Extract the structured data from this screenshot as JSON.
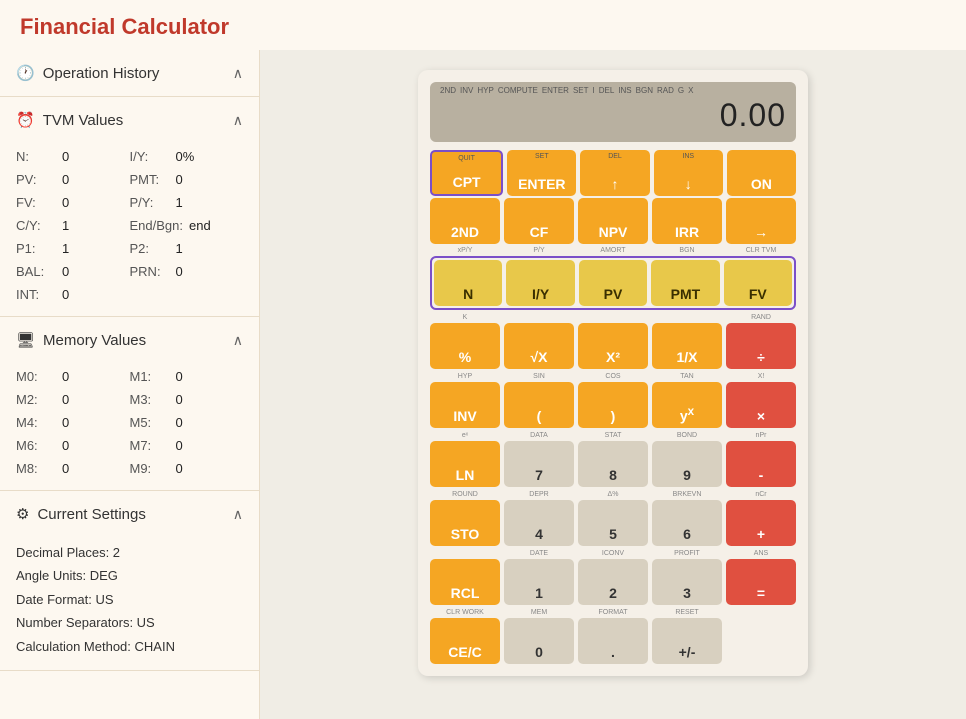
{
  "app": {
    "title": "Financial Calculator"
  },
  "sidebar": {
    "operation_history": {
      "label": "Operation History",
      "icon": "history-icon"
    },
    "tvm": {
      "label": "TVM Values",
      "icon": "clock-icon",
      "fields": [
        {
          "label": "N:",
          "value": "0",
          "label2": "I/Y:",
          "value2": "0%"
        },
        {
          "label": "PV:",
          "value": "0",
          "label2": "PMT:",
          "value2": "0"
        },
        {
          "label": "FV:",
          "value": "0",
          "label2": "P/Y:",
          "value2": "1"
        },
        {
          "label": "C/Y:",
          "value": "1",
          "label2": "End/Bgn:",
          "value2": "end"
        },
        {
          "label": "P1:",
          "value": "1",
          "label2": "P2:",
          "value2": "1"
        },
        {
          "label": "BAL:",
          "value": "0",
          "label2": "PRN:",
          "value2": "0"
        },
        {
          "label": "INT:",
          "value": "0",
          "label2": "",
          "value2": ""
        }
      ]
    },
    "memory": {
      "label": "Memory Values",
      "icon": "memory-icon",
      "fields": [
        {
          "label": "M0:",
          "value": "0",
          "label2": "M1:",
          "value2": "0"
        },
        {
          "label": "M2:",
          "value": "0",
          "label2": "M3:",
          "value2": "0"
        },
        {
          "label": "M4:",
          "value": "0",
          "label2": "M5:",
          "value2": "0"
        },
        {
          "label": "M6:",
          "value": "0",
          "label2": "M7:",
          "value2": "0"
        },
        {
          "label": "M8:",
          "value": "0",
          "label2": "M9:",
          "value2": "0"
        }
      ]
    },
    "settings": {
      "label": "Current Settings",
      "icon": "settings-icon",
      "items": [
        "Decimal Places: 2",
        "Angle Units: DEG",
        "Date Format: US",
        "Number Separators: US",
        "Calculation Method: CHAIN"
      ]
    }
  },
  "calculator": {
    "display": {
      "value": "0.00",
      "top_labels": [
        "2ND",
        "INV",
        "HYP",
        "COMPUTE",
        "ENTER",
        "SET",
        "I",
        "DEL",
        "INS",
        "BGN",
        "RAD",
        "G",
        "X"
      ]
    },
    "rows": [
      {
        "id": "row-quit",
        "buttons": [
          {
            "id": "cpt",
            "label": "CPT",
            "top": "QUIT",
            "color": "orange-outline"
          },
          {
            "id": "enter",
            "label": "ENTER",
            "top": "SET",
            "color": "orange"
          },
          {
            "id": "up",
            "label": "↑",
            "top": "DEL",
            "color": "orange"
          },
          {
            "id": "down",
            "label": "↓",
            "top": "INS",
            "color": "orange"
          },
          {
            "id": "on",
            "label": "ON",
            "top": "",
            "color": "orange"
          }
        ]
      },
      {
        "id": "row-2nd",
        "buttons": [
          {
            "id": "2nd",
            "label": "2ND",
            "top": "",
            "color": "orange"
          },
          {
            "id": "cf",
            "label": "CF",
            "top": "",
            "color": "orange"
          },
          {
            "id": "npv",
            "label": "NPV",
            "top": "",
            "color": "orange"
          },
          {
            "id": "irr",
            "label": "IRR",
            "top": "",
            "color": "orange"
          },
          {
            "id": "arrow",
            "label": "→",
            "top": "",
            "color": "orange"
          }
        ]
      },
      {
        "id": "row-tvm",
        "sub_labels": [
          "xP/Y",
          "P/Y",
          "AMORT",
          "BGN",
          "CLR TVM"
        ],
        "buttons": [
          {
            "id": "n",
            "label": "N",
            "color": "yellow-outline"
          },
          {
            "id": "iy",
            "label": "I/Y",
            "color": "yellow-outline"
          },
          {
            "id": "pv",
            "label": "PV",
            "color": "yellow-outline"
          },
          {
            "id": "pmt",
            "label": "PMT",
            "color": "yellow-outline"
          },
          {
            "id": "fv",
            "label": "FV",
            "color": "yellow-outline"
          }
        ]
      },
      {
        "id": "row-pct",
        "sub_labels": [
          "K",
          "",
          "",
          "",
          "RAND"
        ],
        "buttons": [
          {
            "id": "pct",
            "label": "%",
            "color": "orange"
          },
          {
            "id": "sqrt",
            "label": "√X",
            "color": "orange"
          },
          {
            "id": "x2",
            "label": "X²",
            "color": "orange"
          },
          {
            "id": "inv",
            "label": "1/X",
            "color": "orange"
          },
          {
            "id": "div",
            "label": "÷",
            "color": "red"
          }
        ]
      },
      {
        "id": "row-inv",
        "sub_labels": [
          "HYP",
          "SIN",
          "COS",
          "TAN",
          "X!"
        ],
        "buttons": [
          {
            "id": "inv2",
            "label": "INV",
            "color": "orange"
          },
          {
            "id": "lparen",
            "label": "(",
            "color": "orange"
          },
          {
            "id": "rparen",
            "label": ")",
            "color": "orange"
          },
          {
            "id": "yx",
            "label": "yˣ",
            "color": "orange"
          },
          {
            "id": "mul",
            "label": "×",
            "color": "red"
          }
        ]
      },
      {
        "id": "row-ln",
        "sub_labels": [
          "eˣ",
          "DATA",
          "STAT",
          "BOND",
          "nPr"
        ],
        "buttons": [
          {
            "id": "ln",
            "label": "LN",
            "color": "orange"
          },
          {
            "id": "7",
            "label": "7",
            "color": "gray"
          },
          {
            "id": "8",
            "label": "8",
            "color": "gray"
          },
          {
            "id": "9",
            "label": "9",
            "color": "gray"
          },
          {
            "id": "minus",
            "label": "-",
            "color": "red"
          }
        ]
      },
      {
        "id": "row-sto",
        "sub_labels": [
          "ROUND",
          "DEPR",
          "Δ%",
          "BRKEVN",
          "nCr"
        ],
        "buttons": [
          {
            "id": "sto",
            "label": "STO",
            "color": "orange"
          },
          {
            "id": "4",
            "label": "4",
            "color": "gray"
          },
          {
            "id": "5",
            "label": "5",
            "color": "gray"
          },
          {
            "id": "6",
            "label": "6",
            "color": "gray"
          },
          {
            "id": "plus",
            "label": "+",
            "color": "red"
          }
        ]
      },
      {
        "id": "row-rcl",
        "sub_labels": [
          "",
          "DATE",
          "ICONV",
          "PROFIT",
          "ANS"
        ],
        "buttons": [
          {
            "id": "rcl",
            "label": "RCL",
            "color": "orange"
          },
          {
            "id": "1",
            "label": "1",
            "color": "gray"
          },
          {
            "id": "2",
            "label": "2",
            "color": "gray"
          },
          {
            "id": "3",
            "label": "3",
            "color": "gray"
          },
          {
            "id": "eq",
            "label": "=",
            "color": "red"
          }
        ]
      },
      {
        "id": "row-cec",
        "sub_labels": [
          "CLR WORK",
          "MEM",
          "FORMAT",
          "RESET",
          ""
        ],
        "buttons": [
          {
            "id": "cec",
            "label": "CE/C",
            "color": "orange"
          },
          {
            "id": "0",
            "label": "0",
            "color": "gray"
          },
          {
            "id": "dot",
            "label": ".",
            "color": "gray"
          },
          {
            "id": "plusminus",
            "label": "+/-",
            "color": "gray"
          }
        ]
      }
    ]
  }
}
